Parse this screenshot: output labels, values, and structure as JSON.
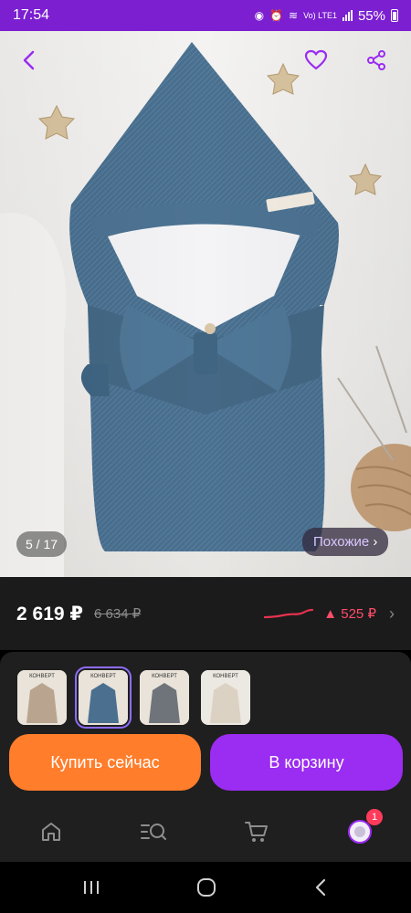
{
  "status_bar": {
    "time": "17:54",
    "network": "Vo) LTE1",
    "battery": "55%"
  },
  "hero": {
    "pager": "5 / 17",
    "similar_label": "Похожие",
    "similar_chevron": "›",
    "icons": {
      "back": "chevron-left-icon",
      "favorite": "heart-icon",
      "share": "share-icon"
    }
  },
  "price": {
    "current": "2 619 ₽",
    "old": "6 634 ₽",
    "delta": "▲ 525 ₽",
    "chevron": "›",
    "colors": {
      "trend": "#ff4d6a",
      "current": "#ffffff",
      "old": "#8a8a8a"
    }
  },
  "variants": [
    {
      "label": "КОНВЕРТ",
      "selected": false
    },
    {
      "label": "КОНВЕРТ",
      "selected": true
    },
    {
      "label": "КОНВЕРТ",
      "selected": false
    },
    {
      "label": "КОНВЕРТ",
      "selected": false
    }
  ],
  "actions": {
    "buy_now": "Купить сейчас",
    "add_to_cart": "В корзину",
    "colors": {
      "buy": "#ff7d2b",
      "cart": "#9b2cf1"
    }
  },
  "bottom_nav": {
    "items": [
      "home-icon",
      "catalog-search-icon",
      "cart-icon",
      "profile-icon"
    ],
    "profile_badge": "1"
  },
  "system_nav": {
    "items": [
      "recents-icon",
      "home-circle-icon",
      "back-icon"
    ]
  }
}
